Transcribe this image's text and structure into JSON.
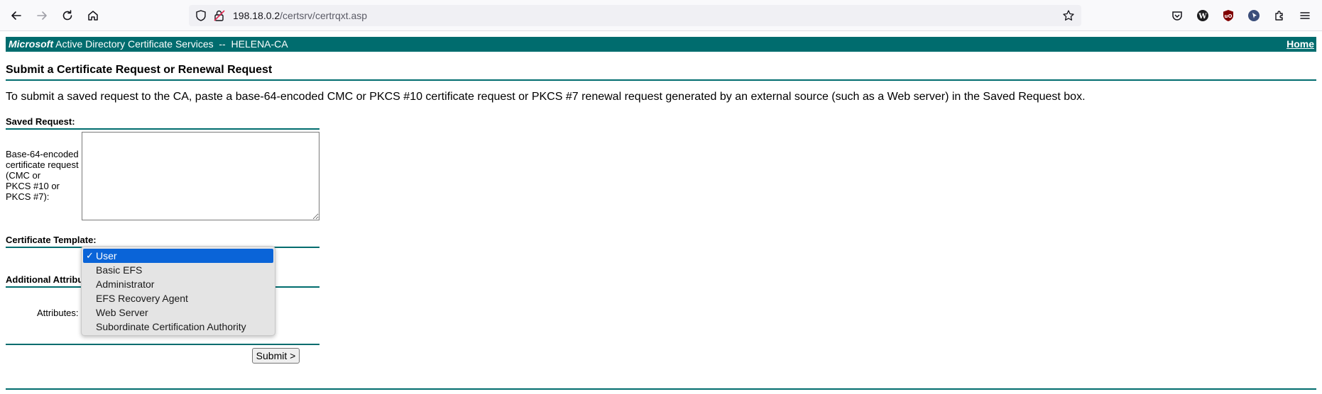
{
  "browser": {
    "url_host": "198.18.0.2",
    "url_path": "/certsrv/certrqxt.asp"
  },
  "colors": {
    "accent": "#006c6e",
    "selection": "#0a64d8"
  },
  "banner": {
    "brand_bold": "Microsoft",
    "brand_text": " Active Directory Certificate Services  --  HELENA-CA",
    "home_link": "Home"
  },
  "page": {
    "heading": "Submit a Certificate Request or Renewal Request",
    "intro": "To submit a saved request to the CA, paste a base-64-encoded CMC or PKCS #10 certificate request or PKCS #7 renewal request generated by an external source (such as a Web server) in the Saved Request box.",
    "saved_request": {
      "section_title": "Saved Request:",
      "field_label_lines": [
        "Base-64-encoded",
        "certificate request",
        "(CMC or",
        "PKCS #10 or",
        "PKCS #7):"
      ],
      "value": ""
    },
    "template": {
      "section_title": "Certificate Template:",
      "options": [
        "User",
        "Basic EFS",
        "Administrator",
        "EFS Recovery Agent",
        "Web Server",
        "Subordinate Certification Authority"
      ],
      "selected": "User",
      "check_mark": "✓"
    },
    "attributes": {
      "section_title": "Additional Attribu",
      "field_label": "Attributes:"
    },
    "submit_label": "Submit >"
  }
}
